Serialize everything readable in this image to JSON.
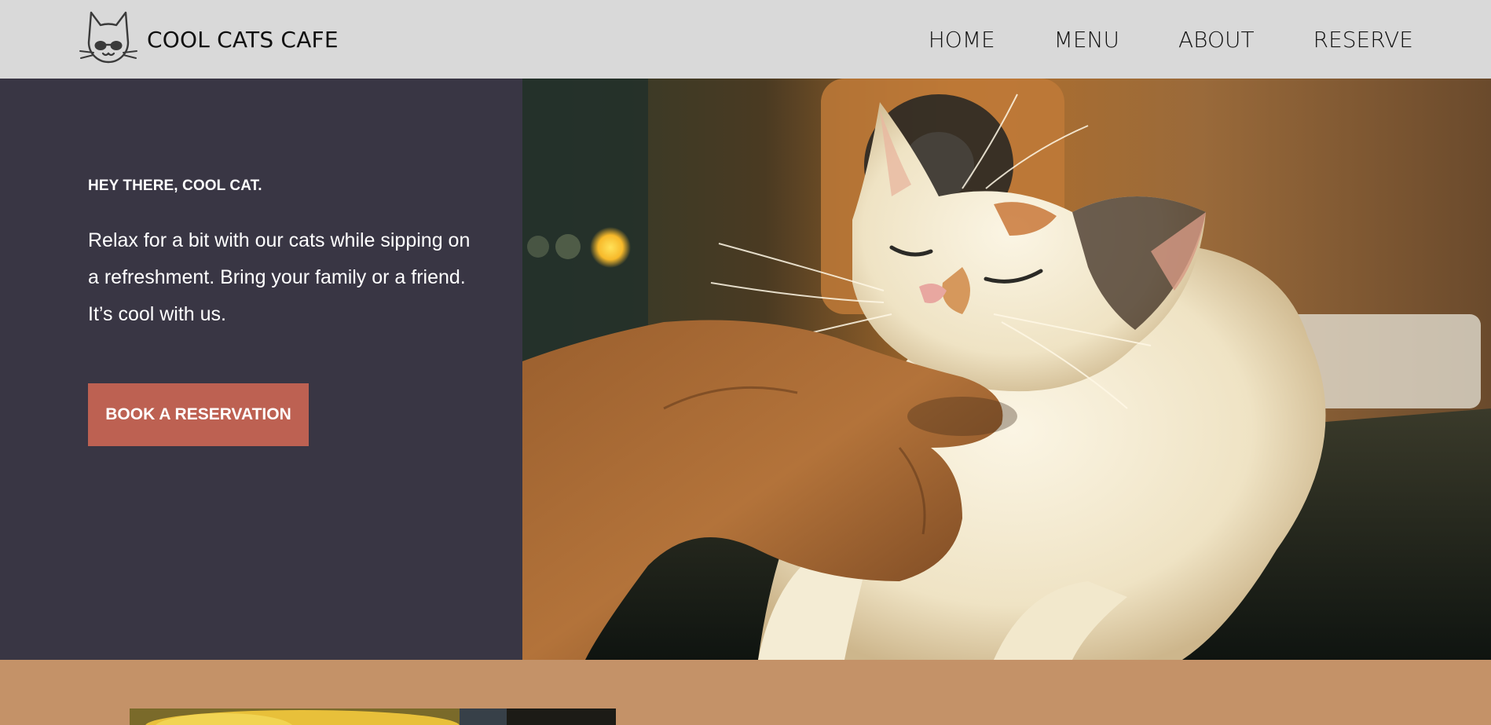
{
  "header": {
    "brand_name": "COOL CATS CAFE",
    "logo_icon": "cat-with-sunglasses-logo",
    "nav": [
      {
        "label": "HOME"
      },
      {
        "label": "MENU"
      },
      {
        "label": "ABOUT"
      },
      {
        "label": "RESERVE"
      }
    ]
  },
  "hero": {
    "eyebrow": "HEY THERE, COOL CAT.",
    "body": "Relax for a bit with our cats while sipping on a refreshment. Bring your family or a friend. It’s cool with us.",
    "cta_label": "BOOK A RESERVATION",
    "image_subject": "calico-cat-being-petted"
  },
  "colors": {
    "header_bg": "#d9d9d9",
    "hero_panel_bg": "#393644",
    "cta_bg": "#bd6152",
    "next_section_bg": "#c49268"
  }
}
